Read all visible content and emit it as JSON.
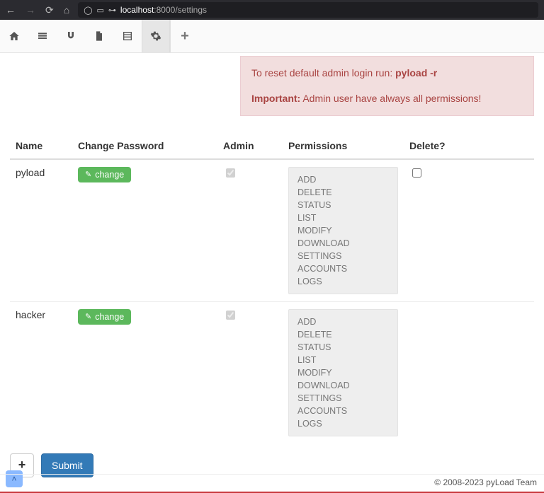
{
  "browser": {
    "url_host": "localhost",
    "url_port": ":8000",
    "url_path": "/settings"
  },
  "alert": {
    "line1_prefix": "To reset default admin login run: ",
    "line1_cmd": "pyload -r",
    "line2_label": "Important:",
    "line2_text": " Admin user have always all permissions!"
  },
  "table": {
    "headers": {
      "name": "Name",
      "change_password": "Change Password",
      "admin": "Admin",
      "permissions": "Permissions",
      "delete": "Delete?"
    },
    "change_button_label": "change",
    "permissions_list": [
      "ADD",
      "DELETE",
      "STATUS",
      "LIST",
      "MODIFY",
      "DOWNLOAD",
      "SETTINGS",
      "ACCOUNTS",
      "LOGS"
    ],
    "users": [
      {
        "name": "pyload",
        "admin_checked": true,
        "admin_disabled": true,
        "delete_checked": false,
        "delete_disabled": false
      },
      {
        "name": "hacker",
        "admin_checked": true,
        "admin_disabled": true,
        "delete_checked": false,
        "delete_disabled": true
      }
    ]
  },
  "actions": {
    "add_label": "+",
    "submit_label": "Submit"
  },
  "footer": {
    "text": "© 2008-2023 pyLoad Team"
  }
}
